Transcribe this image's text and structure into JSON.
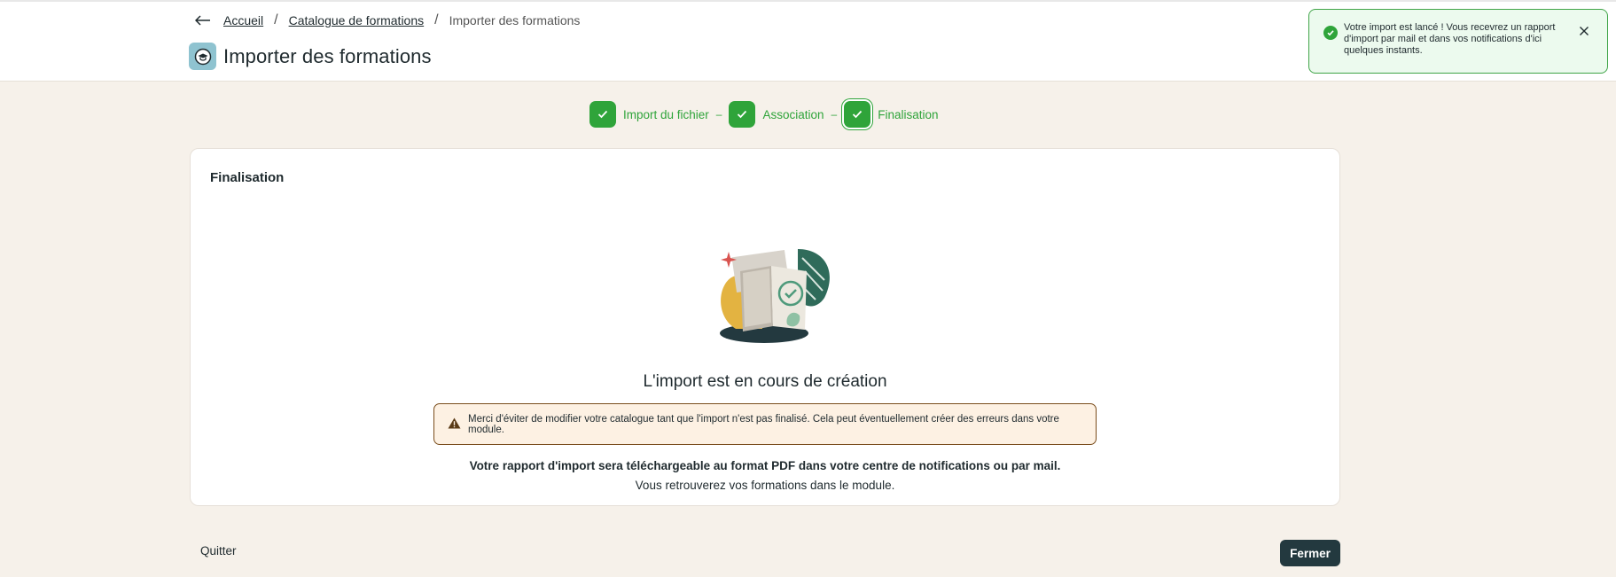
{
  "breadcrumb": {
    "home": "Accueil",
    "catalog": "Catalogue de formations",
    "current": "Importer des formations"
  },
  "page": {
    "title": "Importer des formations"
  },
  "toast": {
    "message": "Votre import est lancé ! Vous recevrez un rapport d'import par mail et dans vos notifications d'ici quelques instants."
  },
  "stepper": {
    "steps": [
      {
        "label": "Import du fichier"
      },
      {
        "label": "Association"
      },
      {
        "label": "Finalisation"
      }
    ]
  },
  "card": {
    "title": "Finalisation",
    "status_title": "L'import est en cours de création",
    "warning": "Merci d'éviter de modifier votre catalogue tant que l'import n'est pas finalisé. Cela peut éventuellement créer des erreurs dans votre module.",
    "report_line": "Votre rapport d'import sera téléchargeable au format PDF dans votre centre de notifications ou par mail.",
    "module_line": "Vous retrouverez vos formations dans le module."
  },
  "footer": {
    "quit_label": "Quitter",
    "close_label": "Fermer"
  },
  "colors": {
    "success": "#2fa43a",
    "background": "#f6f1ea",
    "primary_button": "#23393f",
    "warning_bg": "#fdf1e3"
  },
  "icons": {
    "back": "arrow-left-icon",
    "title": "graduation-cap-icon",
    "toast": "check-circle-icon",
    "toast_close": "close-icon",
    "step": "check-icon",
    "warning": "warning-triangle-icon"
  }
}
